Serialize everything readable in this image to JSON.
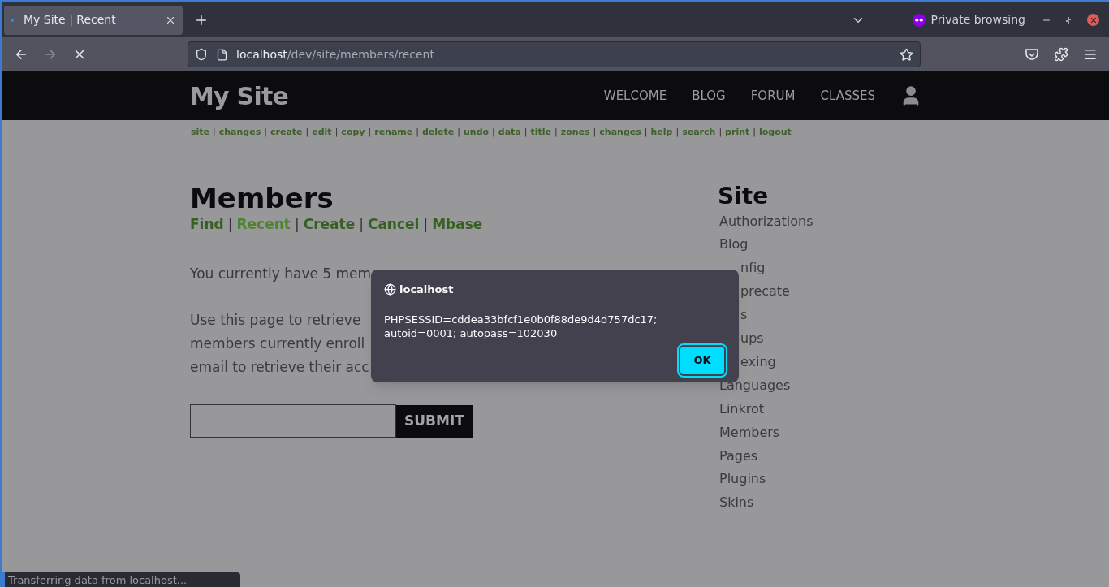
{
  "browser": {
    "tabs": [
      {
        "title": "My Site | Recent",
        "selected": true
      }
    ],
    "private_label": "Private browsing",
    "url": {
      "host": "localhost",
      "path": "/dev/site/members/recent"
    },
    "loading": true
  },
  "site": {
    "logo": "My Site",
    "nav": [
      "WELCOME",
      "BLOG",
      "FORUM",
      "CLASSES"
    ],
    "action_links": [
      "site",
      "changes",
      "create",
      "edit",
      "copy",
      "rename",
      "delete",
      "undo",
      "data",
      "title",
      "zones",
      "changes",
      "help",
      "search",
      "print",
      "logout"
    ],
    "separator": "|",
    "heading": "Members",
    "sub_links": [
      {
        "label": "Find",
        "selected": false
      },
      {
        "label": "Recent",
        "selected": true
      },
      {
        "label": "Create",
        "selected": false
      },
      {
        "label": "Cancel",
        "selected": false
      },
      {
        "label": "Mbase",
        "selected": false
      }
    ],
    "intro": "You currently have 5 mem",
    "paragraph_lines": [
      "Use this page to retrieve",
      "members currently enroll",
      "email to retrieve their acc"
    ],
    "submit": "SUBMIT",
    "sidebar": {
      "title": "Site",
      "items": [
        {
          "label": "Authorizations",
          "kind": "full"
        },
        {
          "label": "Blog",
          "kind": "full"
        },
        {
          "label": "nfig",
          "kind": "partial"
        },
        {
          "label": "precate",
          "kind": "partial"
        },
        {
          "label": "s",
          "kind": "partial"
        },
        {
          "label": "ups",
          "kind": "partial"
        },
        {
          "label": "exing",
          "kind": "partial"
        },
        {
          "label": "Languages",
          "kind": "full"
        },
        {
          "label": "Linkrot",
          "kind": "full"
        },
        {
          "label": "Members",
          "kind": "full"
        },
        {
          "label": "Pages",
          "kind": "full"
        },
        {
          "label": "Plugins",
          "kind": "full"
        },
        {
          "label": "Skins",
          "kind": "full"
        }
      ]
    }
  },
  "dialog": {
    "title": "localhost",
    "message_lines": [
      "PHPSESSID=cddea33bfcf1e0b0f88de9d4d757dc17;",
      "autoid=0001; autopass=102030"
    ],
    "ok": "OK"
  },
  "status_bar": "Transferring data from localhost..."
}
